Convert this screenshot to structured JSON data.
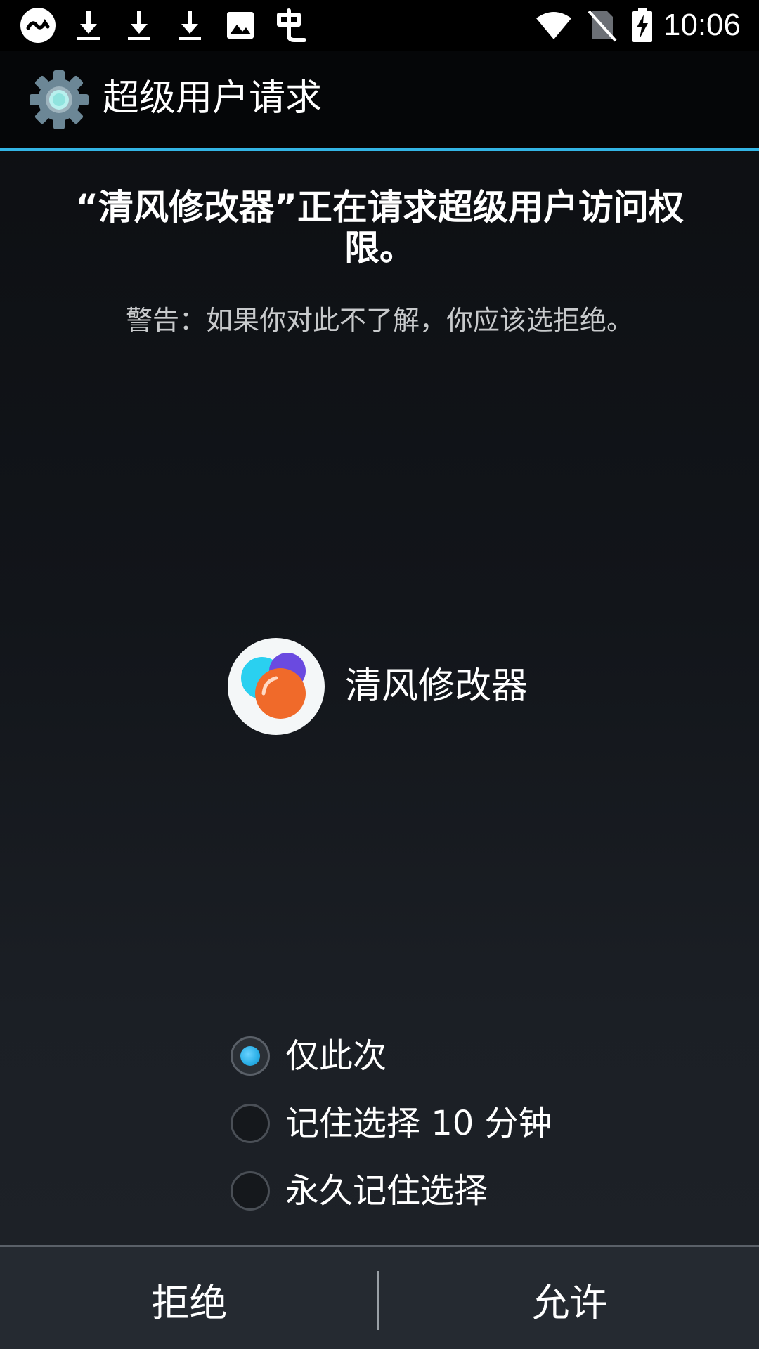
{
  "status_bar": {
    "time": "10:06",
    "icons_left": [
      "link-app-icon",
      "download-icon",
      "download-icon",
      "download-icon",
      "image-icon",
      "cloud-app-icon"
    ],
    "icons_right": [
      "wifi-icon",
      "no-sim-icon",
      "battery-charging-icon"
    ]
  },
  "title_bar": {
    "title": "超级用户请求",
    "icon": "gear-icon"
  },
  "request": {
    "heading": "“清风修改器”正在请求超级用户访问权限。",
    "warning": "警告：如果你对此不了解，你应该选拒绝。"
  },
  "app": {
    "name": "清风修改器",
    "icon": "app-bubbles-icon"
  },
  "options": [
    {
      "label": "仅此次",
      "checked": true
    },
    {
      "label": "记住选择 10 分钟",
      "checked": false
    },
    {
      "label": "永久记住选择",
      "checked": false
    }
  ],
  "buttons": {
    "deny": "拒绝",
    "allow": "允许"
  },
  "colors": {
    "accent": "#33b5e5",
    "radio_selected": "#29aee6",
    "button_bar": "#252a31"
  }
}
